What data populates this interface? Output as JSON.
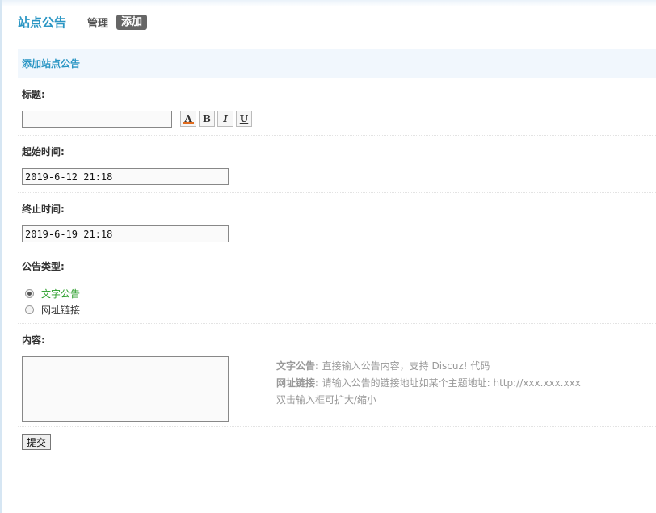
{
  "nav": {
    "title": "站点公告",
    "manage_label": "管理",
    "add_label": "添加"
  },
  "section": {
    "title": "添加站点公告"
  },
  "form": {
    "title_label": "标题:",
    "title_value": "",
    "toolbar": {
      "color": "A",
      "bold": "B",
      "italic": "I",
      "underline": "U",
      "color_bar": "#e06b1f"
    },
    "start_label": "起始时间:",
    "start_value": "2019-6-12 21:18",
    "end_label": "终止时间:",
    "end_value": "2019-6-19 21:18",
    "type_label": "公告类型:",
    "type_options": [
      {
        "label": "文字公告",
        "selected": true,
        "color": "#2a9d2a"
      },
      {
        "label": "网址链接",
        "selected": false,
        "color": "#333333"
      }
    ],
    "content_label": "内容:",
    "content_value": "",
    "tips": {
      "text_title": "文字公告:",
      "text_desc": "直接输入公告内容，支持 Discuz! 代码",
      "link_title": "网址链接:",
      "link_desc": "请输入公告的链接地址如某个主题地址: http://xxx.xxx.xxx",
      "resize_hint": "双击输入框可扩大/缩小"
    },
    "submit_label": "提交"
  }
}
